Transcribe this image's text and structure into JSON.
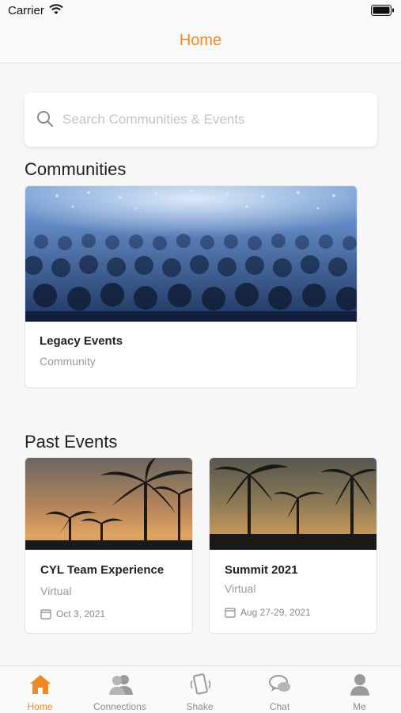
{
  "status": {
    "carrier": "Carrier"
  },
  "nav": {
    "title": "Home"
  },
  "search": {
    "placeholder": "Search Communities & Events",
    "value": ""
  },
  "communities": {
    "title": "Communities",
    "items": [
      {
        "name": "Legacy Events",
        "type": "Community"
      }
    ]
  },
  "past_events": {
    "title": "Past Events",
    "items": [
      {
        "name": "CYL Team Experience",
        "type": "Virtual",
        "date": "Oct 3, 2021"
      },
      {
        "name": "Summit 2021",
        "type": "Virtual",
        "date": "Aug 27-29, 2021"
      }
    ]
  },
  "tabs": [
    {
      "label": "Home",
      "icon": "home-icon",
      "active": true
    },
    {
      "label": "Connections",
      "icon": "connections-icon",
      "active": false
    },
    {
      "label": "Shake",
      "icon": "shake-icon",
      "active": false
    },
    {
      "label": "Chat",
      "icon": "chat-icon",
      "active": false
    },
    {
      "label": "Me",
      "icon": "me-icon",
      "active": false
    }
  ],
  "colors": {
    "accent": "#ee8a26",
    "inactive": "#8e8e8e"
  }
}
